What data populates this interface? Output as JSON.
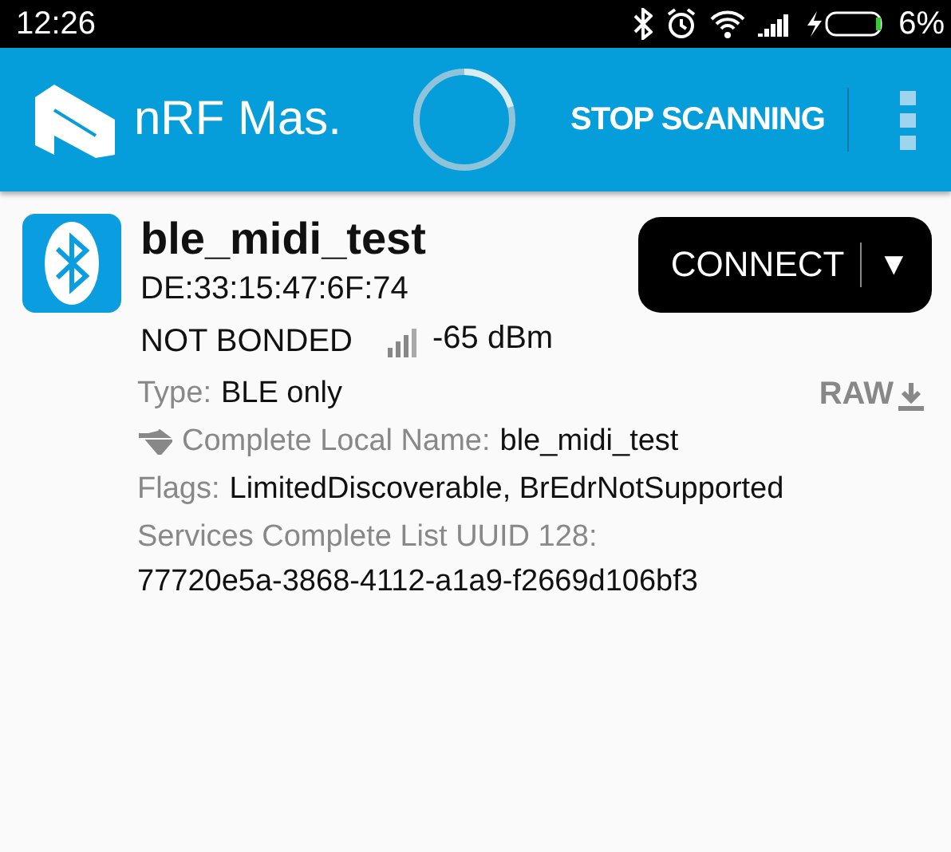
{
  "status_bar": {
    "time": "12:26",
    "battery": "6%"
  },
  "app_bar": {
    "title": "nRF Mas.",
    "action": "STOP SCANNING",
    "scanning": true
  },
  "device": {
    "name": "ble_midi_test",
    "address": "DE:33:15:47:6F:74",
    "bond_state": "NOT BONDED",
    "rssi": "-65 dBm",
    "connect": "CONNECT",
    "dropdown": "▼",
    "raw": "RAW",
    "details": [
      {
        "kind": "inline",
        "label": "Type:",
        "value": "BLE only",
        "icon": false
      },
      {
        "kind": "inline",
        "label": "Complete Local Name:",
        "value": "ble_midi_test",
        "icon": true
      },
      {
        "kind": "inline",
        "label": "Flags:",
        "value": "LimitedDiscoverable, BrEdrNotSupported",
        "icon": false
      },
      {
        "kind": "block",
        "label": "Services Complete List UUID 128:",
        "value": "77720e5a-3868-4112-a1a9-f2669d106bf3",
        "icon": false
      }
    ]
  }
}
